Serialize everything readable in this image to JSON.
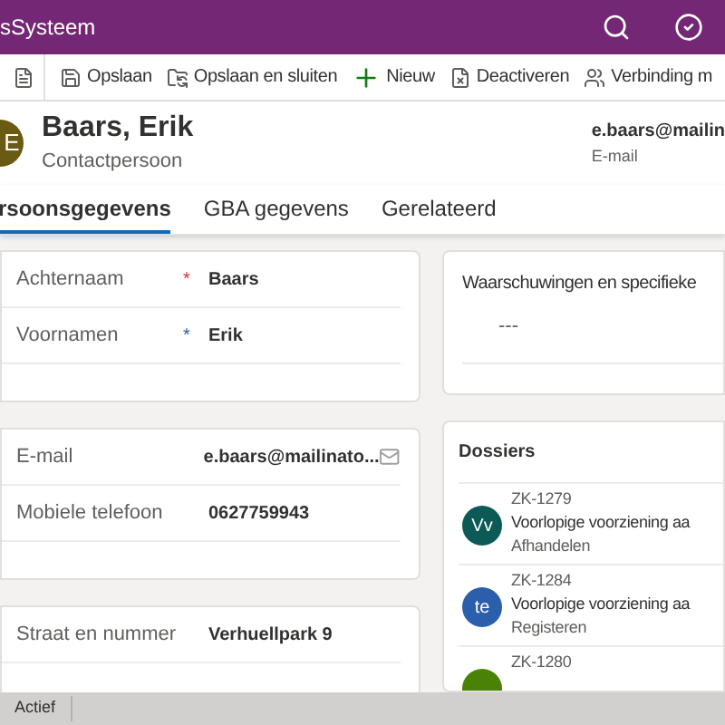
{
  "app_bar": {
    "title": "sSysteem"
  },
  "toolbar": [
    {
      "kind": "form"
    },
    {
      "kind": "save",
      "label": "Opslaan"
    },
    {
      "kind": "save_close",
      "label": "Opslaan en sluiten"
    },
    {
      "kind": "new",
      "label": "Nieuw"
    },
    {
      "kind": "deactivate",
      "label": "Deactiveren"
    },
    {
      "kind": "connect",
      "label": "Verbinding m"
    }
  ],
  "record": {
    "initial": "E",
    "name": "Baars, Erik",
    "type": "Contactpersoon",
    "email_value": "e.baars@mailin",
    "email_label": "E-mail"
  },
  "tabs": [
    {
      "label": "rsoonsgegevens",
      "selected": true
    },
    {
      "label": "GBA gegevens",
      "selected": false
    },
    {
      "label": "Gerelateerd",
      "selected": false
    }
  ],
  "sections": [
    {
      "fields": [
        {
          "label": "Achternaam",
          "mark": {
            "kind": "required",
            "text": "*"
          },
          "value": "Baars"
        },
        {
          "label": "Voornamen",
          "mark": {
            "kind": "recommended",
            "text": "*"
          },
          "value": "Erik"
        }
      ]
    },
    {
      "fields": [
        {
          "label": "E-mail",
          "value": "e.baars@mailinato...",
          "kind": "email"
        },
        {
          "label": "Mobiele telefoon",
          "value": "0627759943"
        }
      ]
    },
    {
      "fields": [
        {
          "label": "Straat en nummer",
          "value": "Verhuellpark 9"
        }
      ]
    }
  ],
  "warnings": {
    "title": "Waarschuwingen en specifieke",
    "value": "---"
  },
  "dossiers": {
    "title": "Dossiers",
    "items": [
      {
        "initials": "Vv",
        "color": "#0b5a55",
        "number": "ZK-1279",
        "description": "Voorlopige voorziening aa",
        "status": "Afhandelen"
      },
      {
        "initials": "te",
        "color": "#2b5fac",
        "number": "ZK-1284",
        "description": "Voorlopige voorziening aa",
        "status": "Registeren"
      },
      {
        "color": "#498205",
        "number": "ZK-1280"
      }
    ]
  },
  "status_bar": {
    "status": "Actief"
  }
}
